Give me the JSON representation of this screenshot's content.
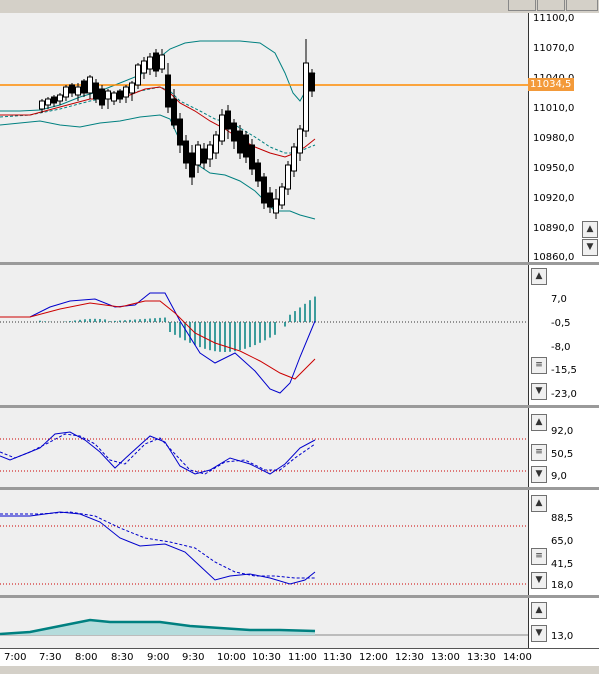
{
  "price_axis": [
    "11100,0",
    "11070,0",
    "11040,0",
    "11010,0",
    "10980,0",
    "10950,0",
    "10920,0",
    "10890,0",
    "10860,0"
  ],
  "price_tag": "11034,5",
  "macd_axis": [
    "7,0",
    "-0,5",
    "-8,0",
    "-15,5",
    "-23,0"
  ],
  "stoch_axis": [
    "92,0",
    "50,5",
    "9,0"
  ],
  "rsi_axis": [
    "88,5",
    "65,0",
    "41,5",
    "18,0"
  ],
  "vol_axis": [
    "13,0"
  ],
  "time_axis": [
    "7:00",
    "7:30",
    "8:00",
    "8:30",
    "9:00",
    "9:30",
    "10:00",
    "10:30",
    "11:00",
    "11:30",
    "12:00",
    "12:30",
    "13:00",
    "13:30",
    "14:00"
  ],
  "colors": {
    "price_line": "#ff8c00",
    "bollinger": "#008080",
    "ma": "#c00000",
    "macd": "#0000cc",
    "signal": "#cc0000",
    "hist": "#008080",
    "ref": "#cc0000"
  },
  "icons": {
    "up": "up-arrow-icon",
    "down": "down-arrow-icon",
    "menu": "menu-icon"
  },
  "chart_data": [
    {
      "type": "candlestick",
      "panel": "price",
      "ylim": [
        10860,
        11100
      ],
      "current_price": 11034.5
    },
    {
      "type": "line",
      "panel": "macd",
      "ylim": [
        -23,
        7
      ]
    },
    {
      "type": "line",
      "panel": "stochastic",
      "ylim": [
        9,
        92
      ]
    },
    {
      "type": "line",
      "panel": "oscillator",
      "ylim": [
        18,
        88.5
      ]
    },
    {
      "type": "area",
      "panel": "volume",
      "ylim": [
        0,
        13
      ]
    }
  ]
}
